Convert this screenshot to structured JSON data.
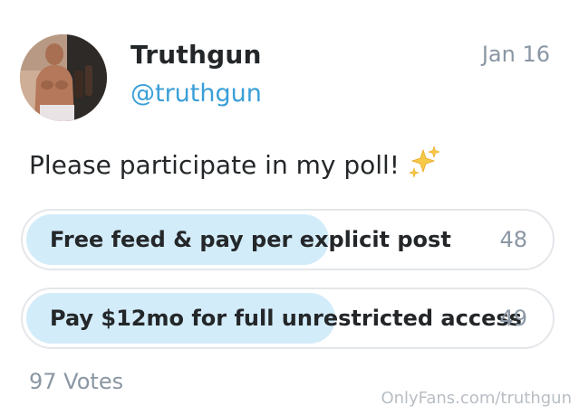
{
  "author": {
    "display_name": "Truthgun",
    "handle": "@truthgun"
  },
  "post": {
    "date": "Jan 16",
    "text": "Please participate in my poll!",
    "emoji_icon": "sparkles-icon"
  },
  "poll": {
    "options": [
      {
        "label": "Free feed & pay per explicit post",
        "votes": "48",
        "fraction": 0.495
      },
      {
        "label": "Pay $12mo for full unrestricted access",
        "votes": "49",
        "fraction": 0.505
      }
    ],
    "total_votes": "97 Votes"
  },
  "watermark": "OnlyFans.com/truthgun",
  "colors": {
    "accent": "#3a9fd8",
    "poll_fill": "#d3ecfa",
    "muted_text": "#8a96a3",
    "primary_text": "#242729"
  }
}
